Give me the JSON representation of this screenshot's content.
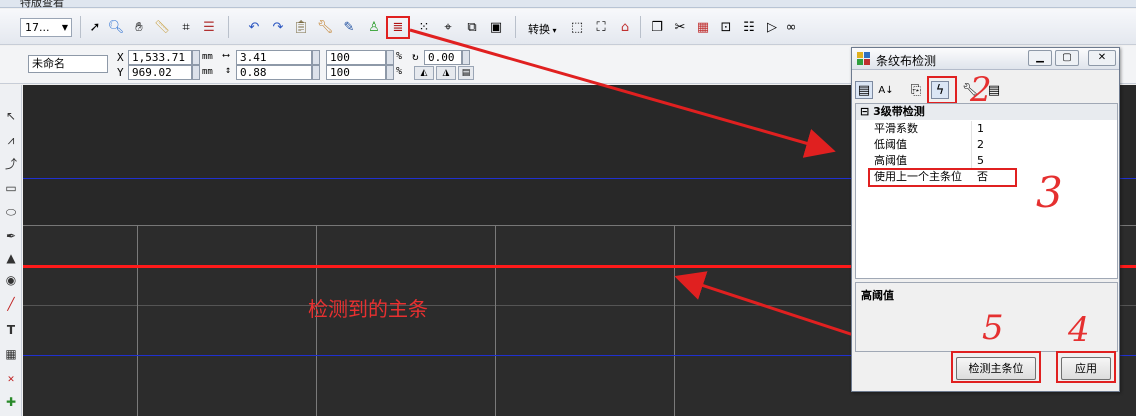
{
  "app": {
    "tab_title": "特版查看"
  },
  "toolbar": {
    "zoom_value": "17...",
    "convert_label": "转换"
  },
  "props": {
    "name_value": "未命名",
    "x_label": "X",
    "y_label": "Y",
    "x_value": "1,533.71",
    "y_value": "969.02",
    "unit": "mm",
    "w_value": "3.41",
    "h_value": "0.88",
    "scale_w": "100",
    "scale_h": "100",
    "percent": "%",
    "angle_value": "0.00"
  },
  "canvas": {
    "annotation": "检测到的主条"
  },
  "dialog": {
    "title": "条纹布检测",
    "category": "3级带检测",
    "rows": [
      {
        "key": "平滑系数",
        "value": "1"
      },
      {
        "key": "低阈值",
        "value": "2"
      },
      {
        "key": "高阈值",
        "value": "5"
      },
      {
        "key": "使用上一个主条位",
        "value": "否"
      }
    ],
    "description_title": "高阈值",
    "detect_button": "检测主条位",
    "apply_button": "应用",
    "cat_toggle": "⊟"
  },
  "callouts": [
    "2",
    "3",
    "5",
    "4"
  ],
  "colors": {
    "accent_red": "#e02020",
    "blue_line": "#2030d0"
  }
}
